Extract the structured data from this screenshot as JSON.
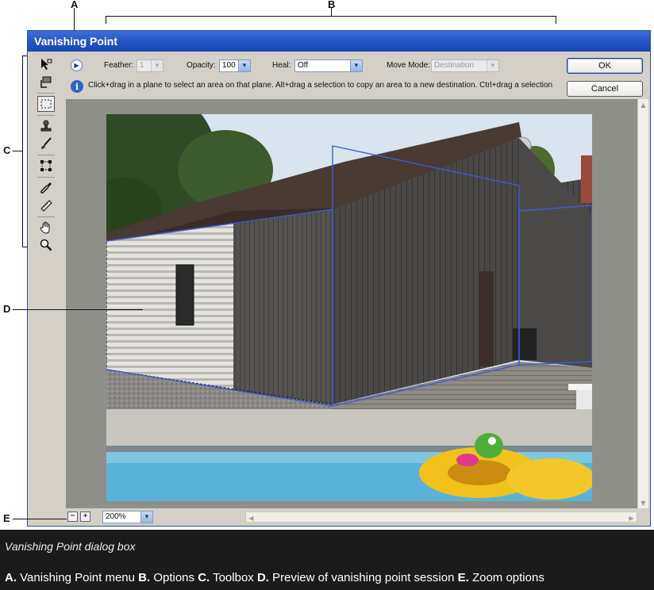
{
  "dialog": {
    "title": "Vanishing Point",
    "options": {
      "feather_label": "Feather:",
      "feather_value": "1",
      "opacity_label": "Opacity:",
      "opacity_value": "100",
      "heal_label": "Heal:",
      "heal_value": "Off",
      "move_mode_label": "Move Mode:",
      "move_mode_value": "Destination"
    },
    "info_text": "Click+drag in a plane to select an area on that plane. Alt+drag a selection to copy an area to a new destination. Ctrl+drag a selection to fill th",
    "ok_label": "OK",
    "cancel_label": "Cancel",
    "zoom_value": "200%",
    "zoom_out_symbol": "−",
    "zoom_in_symbol": "+",
    "tools": [
      "edit-plane-icon",
      "create-plane-icon",
      "marquee-icon",
      "stamp-icon",
      "brush-icon",
      "transform-icon",
      "eyedropper-icon",
      "measure-icon",
      "hand-icon",
      "zoom-icon"
    ]
  },
  "callouts": {
    "a": "A",
    "b": "B",
    "c": "C",
    "d": "D",
    "e": "E"
  },
  "caption": "Vanishing Point dialog box",
  "legend": [
    {
      "key": "A.",
      "text": " Vanishing Point menu "
    },
    {
      "key": "B.",
      "text": " Options "
    },
    {
      "key": "C.",
      "text": " Toolbox "
    },
    {
      "key": "D.",
      "text": " Preview of vanishing point session "
    },
    {
      "key": "E.",
      "text": " Zoom options"
    }
  ],
  "colors": {
    "titlebar": "#2051c4",
    "dialog_bg": "#d4d0c8",
    "plane_grid": "#3b5cd6",
    "page_bg": "#1b1b1b"
  }
}
